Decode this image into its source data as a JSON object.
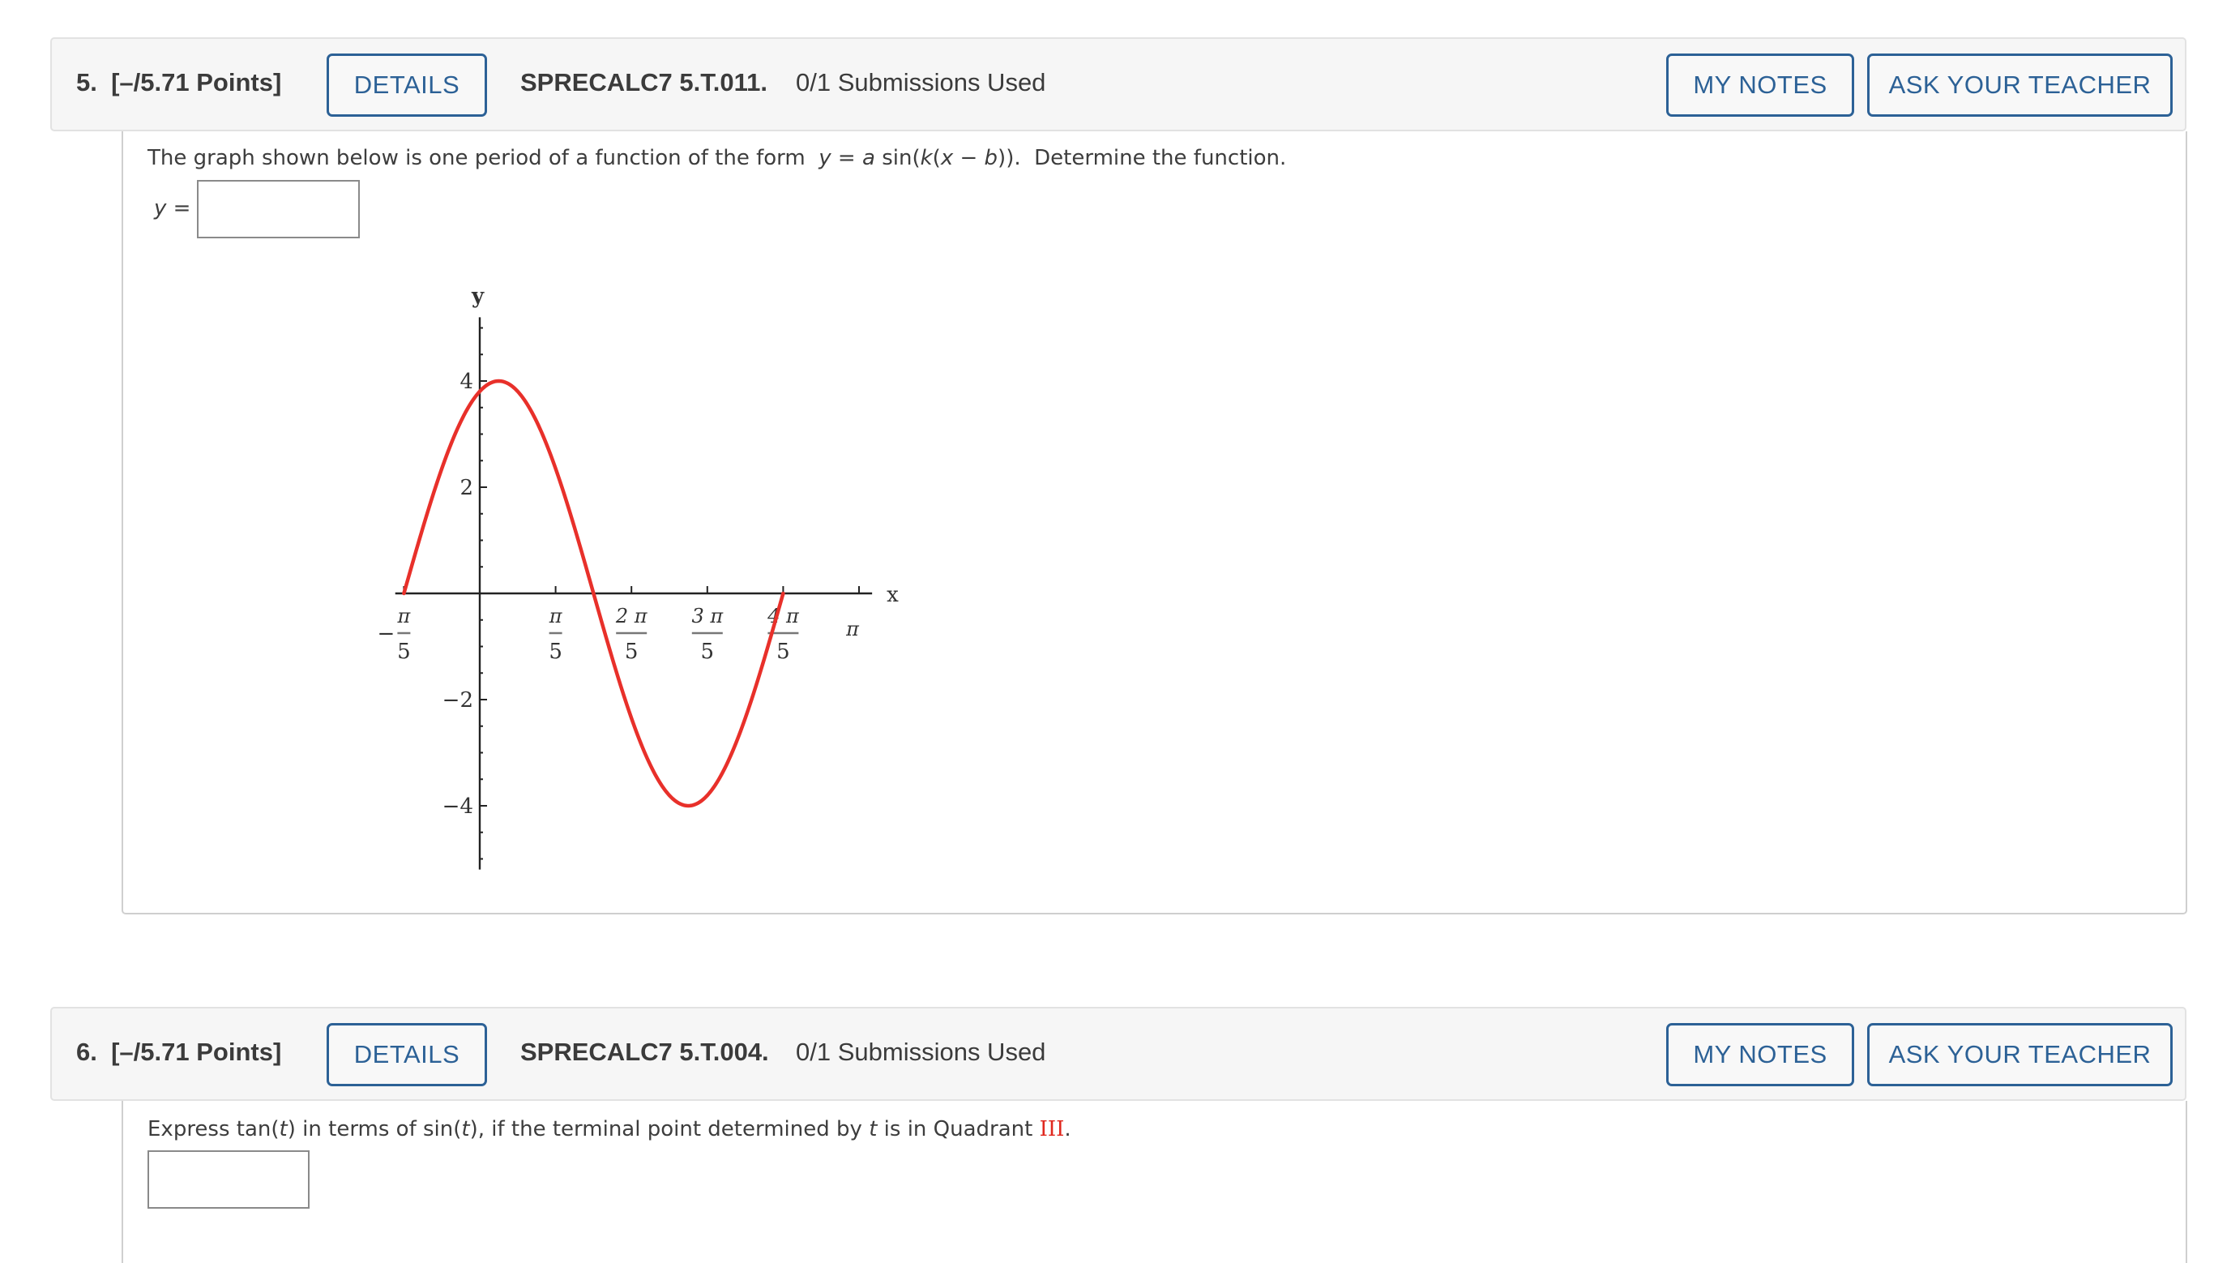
{
  "questions": [
    {
      "number": "5.",
      "points": "[–/5.71 Points]",
      "details_label": "DETAILS",
      "code": "SPRECALC7 5.T.011.",
      "submissions": "0/1 Submissions Used",
      "my_notes_label": "MY NOTES",
      "ask_teacher_label": "ASK YOUR TEACHER",
      "prompt_parts": {
        "p1": "The graph shown below is one period of a function of the form  ",
        "y": "y",
        "eq": " = ",
        "a": "a",
        "sin": " sin(",
        "k": "k",
        "open": "(",
        "x": "x",
        "minus": " − ",
        "b": "b",
        "close": ")).  Determine the function."
      },
      "answer_label_var": "y",
      "answer_label_eq": " =",
      "answer_value": ""
    },
    {
      "number": "6.",
      "points": "[–/5.71 Points]",
      "details_label": "DETAILS",
      "code": "SPRECALC7 5.T.004.",
      "submissions": "0/1 Submissions Used",
      "my_notes_label": "MY NOTES",
      "ask_teacher_label": "ASK YOUR TEACHER",
      "prompt_parts": {
        "p1": "Express tan(",
        "t1": "t",
        "p2": ") in terms of sin(",
        "t2": "t",
        "p3": "), if the terminal point determined by ",
        "t3": "t",
        "p4": " is in Quadrant ",
        "quadrant": "III",
        "p5": "."
      },
      "answer_value": ""
    }
  ],
  "colors": {
    "accent": "#2c6196",
    "curve": "#e8302a",
    "highlight_red": "#e0281e"
  },
  "chart_data": {
    "type": "line",
    "title": "",
    "xlabel": "x",
    "ylabel": "y",
    "function": "y = 4 sin(2(x + π/5))",
    "x_range": [
      -0.7,
      3.25
    ],
    "y_range": [
      -5.2,
      5.2
    ],
    "x_ticks": [
      {
        "value": -0.6283,
        "num": "π",
        "den": "5",
        "sign": "−"
      },
      {
        "value": 0.6283,
        "num": "π",
        "den": "5",
        "sign": ""
      },
      {
        "value": 1.2566,
        "num": "2 π",
        "den": "5",
        "sign": ""
      },
      {
        "value": 1.885,
        "num": "3 π",
        "den": "5",
        "sign": ""
      },
      {
        "value": 2.5133,
        "num": "4 π",
        "den": "5",
        "sign": ""
      },
      {
        "value": 3.1416,
        "num": "π",
        "den": "",
        "sign": ""
      }
    ],
    "y_ticks": [
      {
        "value": 4,
        "label": "4"
      },
      {
        "value": 2,
        "label": "2"
      },
      {
        "value": -2,
        "label": "−2"
      },
      {
        "value": -4,
        "label": "−4"
      }
    ],
    "y_minor_step": 0.5,
    "series": [
      {
        "name": "one period",
        "amplitude": 4,
        "k": 2,
        "b": -0.6283,
        "x_start": -0.6283,
        "x_end": 2.5133
      }
    ],
    "grid": false
  }
}
